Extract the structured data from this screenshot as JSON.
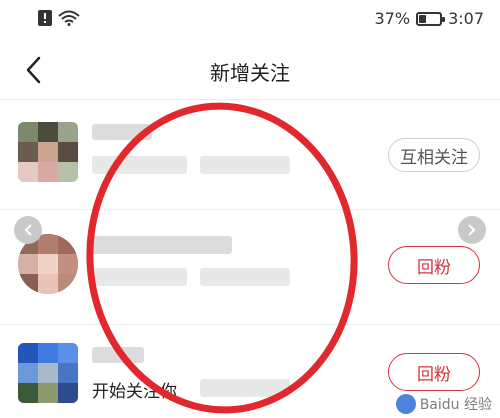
{
  "status_bar": {
    "battery_text": "37%",
    "battery_level": 0.37,
    "time": "3:07"
  },
  "nav": {
    "title": "新增关注"
  },
  "rows": [
    {
      "button_label": "互相关注"
    },
    {
      "button_label": "回粉"
    },
    {
      "caption": "开始关注你",
      "button_label": "回粉"
    }
  ],
  "watermark": {
    "text": "Baidu 经验"
  },
  "colors": {
    "accent_red": "#d6333c",
    "annotation_red": "#e0282d"
  }
}
